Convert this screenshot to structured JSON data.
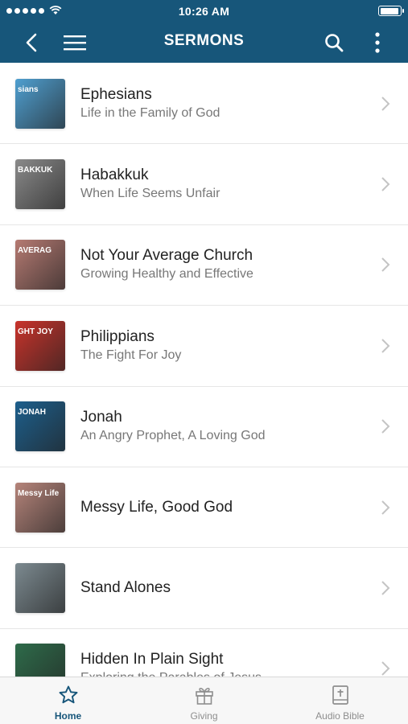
{
  "status_bar": {
    "time": "10:26 AM"
  },
  "header": {
    "title": "SERMONS"
  },
  "sermons": [
    {
      "title": "Ephesians",
      "subtitle": "Life in the Family of God",
      "thumb_text": "sians",
      "thumb_color": "#4f9fd0"
    },
    {
      "title": "Habakkuk",
      "subtitle": "When Life Seems Unfair",
      "thumb_text": "BAKKUK",
      "thumb_color": "#8a8a8a"
    },
    {
      "title": "Not Your Average Church",
      "subtitle": "Growing Healthy and Effective",
      "thumb_text": "AVERAG",
      "thumb_color": "#b57a72"
    },
    {
      "title": "Philippians",
      "subtitle": "The Fight For Joy",
      "thumb_text": "GHT  JOY",
      "thumb_color": "#c8332b"
    },
    {
      "title": "Jonah",
      "subtitle": "An Angry Prophet, A Loving God",
      "thumb_text": "JONAH",
      "thumb_color": "#1d5f8c"
    },
    {
      "title": "Messy Life, Good God",
      "subtitle": "",
      "thumb_text": "Messy Life",
      "thumb_color": "#b5847a"
    },
    {
      "title": "Stand Alones",
      "subtitle": "",
      "thumb_text": "",
      "thumb_color": "#7c8a90"
    },
    {
      "title": "Hidden In Plain Sight",
      "subtitle": "Exploring the Parables of Jesus",
      "thumb_text": "",
      "thumb_color": "#2e6b4a"
    }
  ],
  "tabs": [
    {
      "label": "Home",
      "icon": "star-icon",
      "active": true
    },
    {
      "label": "Giving",
      "icon": "gift-icon",
      "active": false
    },
    {
      "label": "Audio Bible",
      "icon": "bible-icon",
      "active": false
    }
  ],
  "colors": {
    "brand": "#17567a",
    "active_tab": "#17567a",
    "inactive_tab": "#8e8e8e"
  },
  "battery_level": 0.95
}
